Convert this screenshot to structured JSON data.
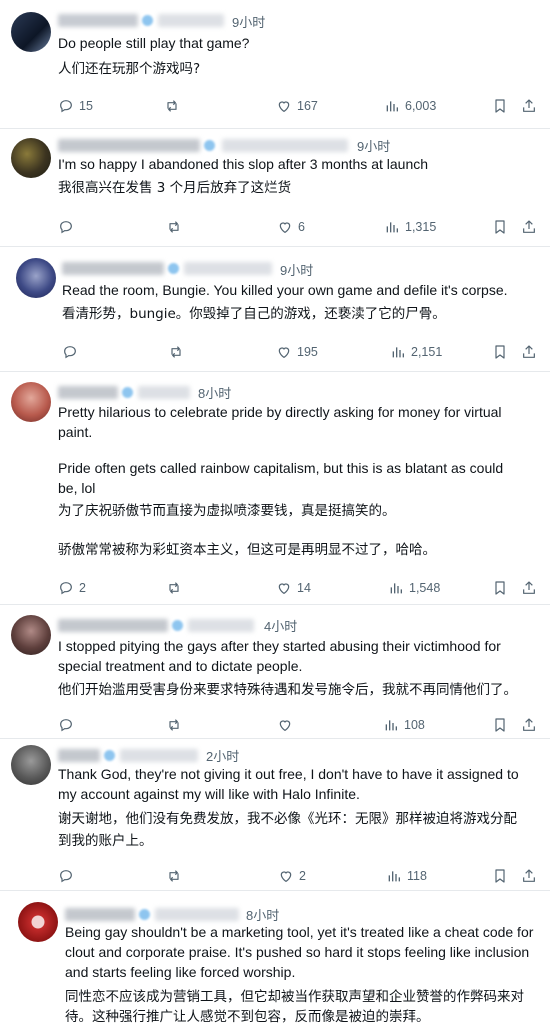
{
  "tweets": [
    {
      "time": "9小时",
      "text_en": [
        "Do people still play that game?"
      ],
      "text_zh": [
        "人们还在玩那个游戏吗?"
      ],
      "replies": "15",
      "reposts": "",
      "likes": "167",
      "views": "6,003"
    },
    {
      "time": "9小时",
      "text_en": [
        "I'm so happy I abandoned this slop after 3 months at launch"
      ],
      "text_zh": [
        "我很高兴在发售 3 个月后放弃了这烂货"
      ],
      "replies": "",
      "reposts": "",
      "likes": "6",
      "views": "1,315"
    },
    {
      "time": "9小时",
      "text_en": [
        "Read the room, Bungie.  You killed your own game and defile it's corpse."
      ],
      "text_zh": [
        "看清形势，bungie。你毁掉了自己的游戏，还亵渎了它的尸骨。"
      ],
      "replies": "",
      "reposts": "",
      "likes": "195",
      "views": "2,151"
    },
    {
      "time": "8小时",
      "text_en": [
        "Pretty hilarious to celebrate pride by directly asking for money for virtual",
        "paint.",
        "",
        "Pride often gets called rainbow capitalism, but this is as blatant as could",
        "be, lol"
      ],
      "text_zh": [
        "为了庆祝骄傲节而直接为虚拟喷漆要钱，真是挺搞笑的。",
        "",
        "骄傲常常被称为彩虹资本主义，但这可是再明显不过了，哈哈。"
      ],
      "replies": "2",
      "reposts": "",
      "likes": "14",
      "views": "1,548"
    },
    {
      "time": "4小时",
      "text_en": [
        "I stopped pitying the gays after they started abusing their victimhood for",
        "special treatment and to dictate people."
      ],
      "text_zh": [
        "他们开始滥用受害身份来要求特殊待遇和发号施令后，我就不再同情他们了。"
      ],
      "replies": "",
      "reposts": "",
      "likes": "",
      "views": "108"
    },
    {
      "time": "2小时",
      "text_en": [
        "Thank God, they're not giving it out free, I don't have to have it assigned to",
        "my account against my will like with Halo Infinite."
      ],
      "text_zh": [
        "谢天谢地，他们没有免费发放，我不必像《光环：无限》那样被迫将游戏分配",
        "到我的账户上。"
      ],
      "replies": "",
      "reposts": "",
      "likes": "2",
      "views": "118"
    },
    {
      "time": "8小时",
      "text_en": [
        "Being gay shouldn't be a marketing tool, yet it's treated like a cheat code for",
        "clout and corporate praise. It's pushed so hard it stops feeling like inclusion",
        "and starts feeling like forced worship."
      ],
      "text_zh": [
        "同性恋不应该成为营销工具，但它却被当作获取声望和企业赞誉的作弊码来对",
        "待。这种强行推广让人感觉不到包容，反而像是被迫的崇拜。"
      ]
    }
  ],
  "colors": {
    "text": "#0f1419",
    "muted": "#536471",
    "verified": "#8ec5ef",
    "divider": "#e6e9ec"
  },
  "icons": [
    "reply-icon",
    "repost-icon",
    "like-icon",
    "views-icon",
    "bookmark-icon",
    "share-icon"
  ]
}
